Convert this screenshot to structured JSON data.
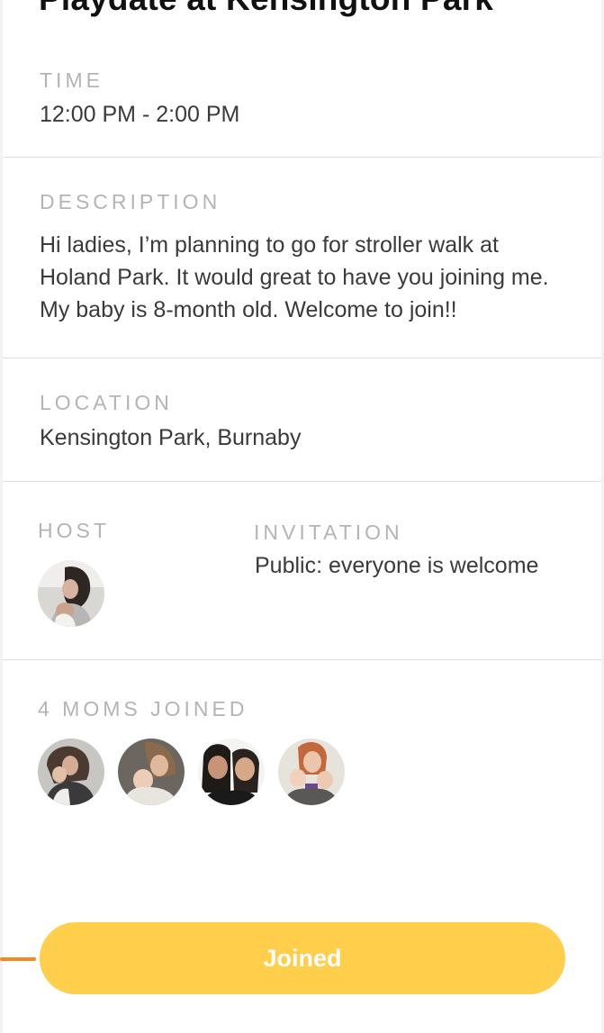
{
  "event": {
    "title": "Playdate at Kensington Park"
  },
  "time": {
    "label": "TIME",
    "value": "12:00 PM - 2:00 PM"
  },
  "description": {
    "label": "DESCRIPTION",
    "value": "Hi ladies, I’m planning to go for stroller walk at Holand Park. It would great to have you joining me. My baby is 8-month old. Welcome to join!!"
  },
  "location": {
    "label": "LOCATION",
    "value": "Kensington Park, Burnaby"
  },
  "host": {
    "label": "HOST",
    "avatar_icon": "host-avatar-photo"
  },
  "invitation": {
    "label": "INVITATION",
    "value": "Public: everyone is welcome"
  },
  "members": {
    "label": "4 MOMS JOINED",
    "avatars": [
      "member-avatar-photo",
      "member-avatar-photo",
      "member-avatar-photo",
      "member-avatar-photo"
    ]
  },
  "action": {
    "joined_label": "Joined"
  },
  "colors": {
    "accent": "#ffce4a",
    "indicator": "#f08a24",
    "label": "#b4b4b4",
    "text": "#3a3a3a"
  }
}
